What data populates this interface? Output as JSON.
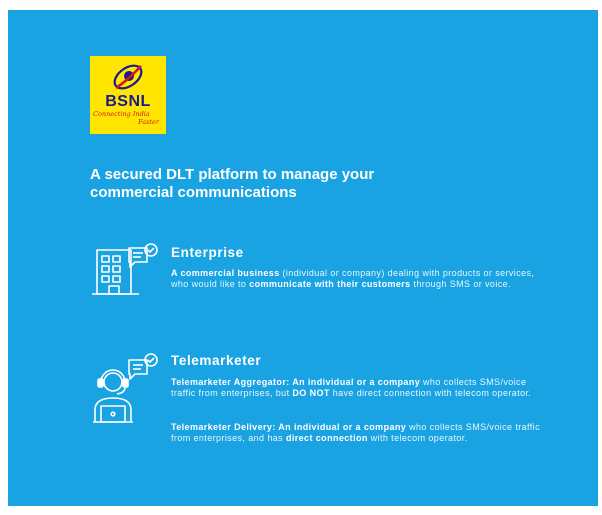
{
  "brand": {
    "name": "BSNL",
    "tagline_line1": "Connecting India",
    "tagline_line2": "Faster",
    "logo_bg": "#ffe600",
    "logo_text_color": "#1a1a8c"
  },
  "headline": {
    "line1": "A secured DLT platform to manage your",
    "line2": "commercial communications"
  },
  "enterprise": {
    "icon": "office-building-icon",
    "title": "Enterprise",
    "desc_bold1": "A commercial business",
    "desc_text1": " (individual or company) dealing with products or services, who would like to ",
    "desc_bold2": "communicate with their customers",
    "desc_text2": " through SMS or voice."
  },
  "telemarketer": {
    "icon": "headset-agent-icon",
    "title": "Telemarketer",
    "aggregator": {
      "bold1": "Telemarketer Aggregator: An individual or a company",
      "text1": " who collects SMS/voice traffic from enterprises, but ",
      "bold2": "DO NOT",
      "text2": " have direct connection with telecom operator."
    },
    "delivery": {
      "bold1": "Telemarketer Delivery: An individual or a company",
      "text1": " who collects SMS/voice traffic from enterprises, and has ",
      "bold2": "direct connection",
      "text2": " with telecom operator."
    }
  },
  "colors": {
    "background": "#1aa3e3",
    "text": "#ffffff"
  }
}
